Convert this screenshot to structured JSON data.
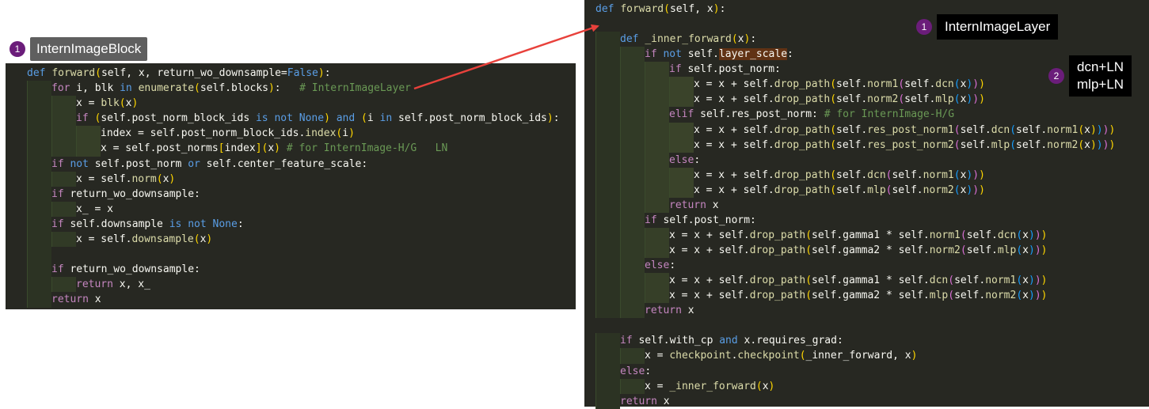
{
  "annotations": {
    "block": {
      "number": "1",
      "label": "InternImageBlock"
    },
    "layer": {
      "number": "1",
      "label": "InternImageLayer"
    },
    "note": {
      "number": "2",
      "line1": "dcn+LN",
      "line2": "mlp+LN"
    }
  },
  "colors": {
    "editor_bg": "#272822",
    "badge": "#6b1d7a",
    "arrow": "#e8413b"
  },
  "left_code": [
    {
      "indent": 0,
      "html": "<span class='kw'>def</span> <span class='fn'>forward</span><span class='par'>(</span>self, x, return_wo_downsample=<span class='kw'>False</span><span class='par'>)</span>:"
    },
    {
      "indent": 1,
      "html": "<span class='kw2'>for</span> i, blk <span class='kw'>in</span> <span class='fn'>enumerate</span><span class='par'>(</span>self.blocks<span class='par'>)</span>:   <span class='cm'># InternImageLayer</span>"
    },
    {
      "indent": 2,
      "html": "x = <span class='fn'>blk</span><span class='par'>(</span>x<span class='par'>)</span>"
    },
    {
      "indent": 2,
      "html": "<span class='kw2'>if</span> <span class='par'>(</span>self.post_norm_block_ids <span class='kw'>is not None</span><span class='par'>)</span> <span class='kw'>and</span> <span class='par'>(</span>i <span class='kw'>in</span> self.post_norm_block_ids<span class='par'>)</span>:"
    },
    {
      "indent": 3,
      "html": "index = self.post_norm_block_ids.<span class='fn'>index</span><span class='par'>(</span>i<span class='par'>)</span>"
    },
    {
      "indent": 3,
      "html": "x = self.post_norms<span class='par'>[</span>index<span class='par'>]</span><span class='par'>(</span>x<span class='par'>)</span> <span class='cm'># for InternImage-H/G   LN</span>"
    },
    {
      "indent": 1,
      "html": "<span class='kw2'>if</span> <span class='kw'>not</span> self.post_norm <span class='kw'>or</span> self.center_feature_scale:"
    },
    {
      "indent": 2,
      "html": "x = self.<span class='fn'>norm</span><span class='par'>(</span>x<span class='par'>)</span>"
    },
    {
      "indent": 1,
      "html": "<span class='kw2'>if</span> return_wo_downsample:"
    },
    {
      "indent": 2,
      "html": "x_ = x"
    },
    {
      "indent": 1,
      "html": "<span class='kw2'>if</span> self.downsample <span class='kw'>is not None</span>:"
    },
    {
      "indent": 2,
      "html": "x = self.<span class='fn'>downsample</span><span class='par'>(</span>x<span class='par'>)</span>"
    },
    {
      "indent": 1,
      "html": ""
    },
    {
      "indent": 1,
      "html": "<span class='kw2'>if</span> return_wo_downsample:"
    },
    {
      "indent": 2,
      "html": "<span class='kw2'>return</span> x, x_"
    },
    {
      "indent": 1,
      "html": "<span class='kw2'>return</span> x"
    }
  ],
  "right_code": [
    {
      "indent": 0,
      "html": "<span class='kw'>def</span> <span class='fn'>forward</span><span class='par'>(</span>self, x<span class='par'>)</span>:"
    },
    {
      "indent": 0,
      "html": ""
    },
    {
      "indent": 1,
      "html": "<span class='kw'>def</span> <span class='fn'>_inner_forward</span><span class='par'>(</span>x<span class='par'>)</span>:"
    },
    {
      "indent": 2,
      "html": "<span class='kw2'>if</span> <span class='kw'>not</span> self.<span class='hl'>layer_scale</span>:"
    },
    {
      "indent": 3,
      "html": "<span class='kw2'>if</span> self.post_norm:"
    },
    {
      "indent": 4,
      "html": "x = x + self.<span class='fn'>drop_path</span><span class='par'>(</span>self.<span class='fn'>norm1</span><span class='par2'>(</span>self.<span class='fn'>dcn</span><span class='par3'>(</span>x<span class='par3'>)</span><span class='par2'>)</span><span class='par'>)</span>"
    },
    {
      "indent": 4,
      "html": "x = x + self.<span class='fn'>drop_path</span><span class='par'>(</span>self.<span class='fn'>norm2</span><span class='par2'>(</span>self.<span class='fn'>mlp</span><span class='par3'>(</span>x<span class='par3'>)</span><span class='par2'>)</span><span class='par'>)</span>"
    },
    {
      "indent": 3,
      "html": "<span class='kw2'>elif</span> self.res_post_norm: <span class='cm'># for InternImage-H/G</span>"
    },
    {
      "indent": 4,
      "html": "x = x + self.<span class='fn'>drop_path</span><span class='par'>(</span>self.<span class='fn'>res_post_norm1</span><span class='par2'>(</span>self.<span class='fn'>dcn</span><span class='par3'>(</span>self.<span class='fn'>norm1</span><span class='par'>(</span>x<span class='par'>)</span><span class='par3'>)</span><span class='par2'>)</span><span class='par'>)</span>"
    },
    {
      "indent": 4,
      "html": "x = x + self.<span class='fn'>drop_path</span><span class='par'>(</span>self.<span class='fn'>res_post_norm2</span><span class='par2'>(</span>self.<span class='fn'>mlp</span><span class='par3'>(</span>self.<span class='fn'>norm2</span><span class='par'>(</span>x<span class='par'>)</span><span class='par3'>)</span><span class='par2'>)</span><span class='par'>)</span>"
    },
    {
      "indent": 3,
      "html": "<span class='kw2'>else</span>:"
    },
    {
      "indent": 4,
      "html": "x = x + self.<span class='fn'>drop_path</span><span class='par'>(</span>self.<span class='fn'>dcn</span><span class='par2'>(</span>self.<span class='fn'>norm1</span><span class='par3'>(</span>x<span class='par3'>)</span><span class='par2'>)</span><span class='par'>)</span>"
    },
    {
      "indent": 4,
      "html": "x = x + self.<span class='fn'>drop_path</span><span class='par'>(</span>self.<span class='fn'>mlp</span><span class='par2'>(</span>self.<span class='fn'>norm2</span><span class='par3'>(</span>x<span class='par3'>)</span><span class='par2'>)</span><span class='par'>)</span>"
    },
    {
      "indent": 3,
      "html": "<span class='kw2'>return</span> x"
    },
    {
      "indent": 2,
      "html": "<span class='kw2'>if</span> self.post_norm:"
    },
    {
      "indent": 3,
      "html": "x = x + self.<span class='fn'>drop_path</span><span class='par'>(</span>self.gamma1 * self.<span class='fn'>norm1</span><span class='par2'>(</span>self.<span class='fn'>dcn</span><span class='par3'>(</span>x<span class='par3'>)</span><span class='par2'>)</span><span class='par'>)</span>"
    },
    {
      "indent": 3,
      "html": "x = x + self.<span class='fn'>drop_path</span><span class='par'>(</span>self.gamma2 * self.<span class='fn'>norm2</span><span class='par2'>(</span>self.<span class='fn'>mlp</span><span class='par3'>(</span>x<span class='par3'>)</span><span class='par2'>)</span><span class='par'>)</span>"
    },
    {
      "indent": 2,
      "html": "<span class='kw2'>else</span>:"
    },
    {
      "indent": 3,
      "html": "x = x + self.<span class='fn'>drop_path</span><span class='par'>(</span>self.gamma1 * self.<span class='fn'>dcn</span><span class='par2'>(</span>self.<span class='fn'>norm1</span><span class='par3'>(</span>x<span class='par3'>)</span><span class='par2'>)</span><span class='par'>)</span>"
    },
    {
      "indent": 3,
      "html": "x = x + self.<span class='fn'>drop_path</span><span class='par'>(</span>self.gamma2 * self.<span class='fn'>mlp</span><span class='par2'>(</span>self.<span class='fn'>norm2</span><span class='par3'>(</span>x<span class='par3'>)</span><span class='par2'>)</span><span class='par'>)</span>"
    },
    {
      "indent": 2,
      "html": "<span class='kw2'>return</span> x"
    },
    {
      "indent": 0,
      "html": ""
    },
    {
      "indent": 1,
      "html": "<span class='kw2'>if</span> self.with_cp <span class='kw'>and</span> x.requires_grad:"
    },
    {
      "indent": 2,
      "html": "x = <span class='fn'>checkpoint</span>.<span class='fn'>checkpoint</span><span class='par'>(</span>_inner_forward, x<span class='par'>)</span>"
    },
    {
      "indent": 1,
      "html": "<span class='kw2'>else</span>:"
    },
    {
      "indent": 2,
      "html": "x = <span class='fn'>_inner_forward</span><span class='par'>(</span>x<span class='par'>)</span>"
    },
    {
      "indent": 1,
      "html": "<span class='kw2'>return</span> x"
    }
  ]
}
